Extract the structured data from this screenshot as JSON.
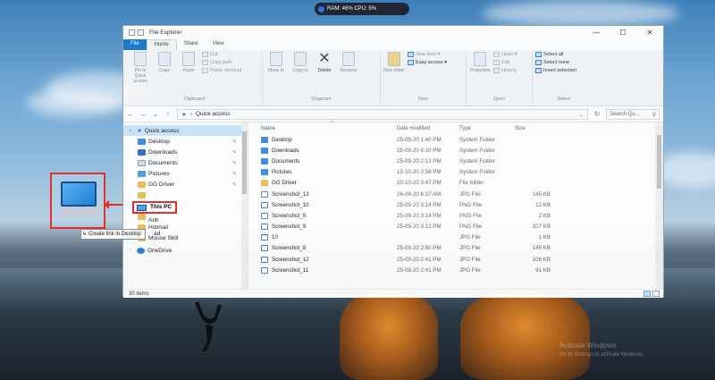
{
  "status_pill": {
    "text": "RAM: 46%  CPU: 5%"
  },
  "watermark": {
    "line1": "Activate Windows",
    "line2": "Go to Settings to activate Windows."
  },
  "desktop": {
    "drag_label": "This PC",
    "tooltip": "Create link in Desktop",
    "behind_labels": [
      "Anh",
      "Hotmail",
      "Mouse Skill",
      "ad"
    ]
  },
  "window": {
    "title": "File Explorer",
    "controls": {
      "minimize": "—",
      "maximize": "☐",
      "close": "✕"
    },
    "tabs": {
      "file": "File",
      "home": "Home",
      "share": "Share",
      "view": "View"
    },
    "ribbon": {
      "clipboard": {
        "name": "Clipboard",
        "pin": "Pin to Quick access",
        "copy": "Copy",
        "paste": "Paste",
        "cut": "Cut",
        "copy_path": "Copy path",
        "paste_shortcut": "Paste shortcut"
      },
      "organize": {
        "name": "Organize",
        "move_to": "Move to",
        "copy_to": "Copy to",
        "delete": "Delete",
        "rename": "Rename"
      },
      "new": {
        "name": "New",
        "new_folder": "New folder",
        "new_item": "New item ▾",
        "easy_access": "Easy access ▾"
      },
      "open": {
        "name": "Open",
        "properties": "Properties",
        "open": "Open ▾",
        "edit": "Edit",
        "history": "History"
      },
      "select": {
        "name": "Select",
        "select_all": "Select all",
        "select_none": "Select none",
        "invert": "Invert selection"
      }
    },
    "address": {
      "path": "Quick access",
      "search_placeholder": "Search Qu..."
    },
    "nav": {
      "quick_access": "Quick access",
      "items": [
        {
          "label": "Desktop",
          "icon": "desktop-icon",
          "pinned": true
        },
        {
          "label": "Downloads",
          "icon": "download-icon",
          "pinned": true
        },
        {
          "label": "Documents",
          "icon": "documents-icon",
          "pinned": true
        },
        {
          "label": "Pictures",
          "icon": "pictures-icon",
          "pinned": true
        },
        {
          "label": "GG Driver",
          "icon": "folder-icon",
          "pinned": true
        },
        {
          "label": "",
          "icon": "folder-icon",
          "pinned": false
        },
        {
          "label": "",
          "icon": "folder-icon",
          "pinned": false
        },
        {
          "label": "",
          "icon": "folder-icon",
          "pinned": false
        },
        {
          "label": "Hotmail",
          "icon": "folder-icon",
          "pinned": false
        },
        {
          "label": "Mouse Skill",
          "icon": "folder-icon",
          "pinned": false
        }
      ],
      "onedrive": "OneDrive"
    },
    "columns": {
      "name": "Name",
      "date": "Date modified",
      "type": "Type",
      "size": "Size"
    },
    "files": [
      {
        "name": "Desktop",
        "date": "25-09-20 1:40 PM",
        "type": "System Folder",
        "size": "",
        "kind": "folderblue"
      },
      {
        "name": "Downloads",
        "date": "25-09-20 4:10 PM",
        "type": "System Folder",
        "size": "",
        "kind": "folderblue"
      },
      {
        "name": "Documents",
        "date": "25-09-20 2:13 PM",
        "type": "System Folder",
        "size": "",
        "kind": "folderblue"
      },
      {
        "name": "Pictures",
        "date": "15-10-20 3:56 PM",
        "type": "System Folder",
        "size": "",
        "kind": "folderblue"
      },
      {
        "name": "GG Driver",
        "date": "20-10-20 3:47 PM",
        "type": "File folder",
        "size": "",
        "kind": "folder"
      },
      {
        "name": "Screenshot_13",
        "date": "26-09-20 6:37 AM",
        "type": "JPG File",
        "size": "145 KB",
        "kind": "img"
      },
      {
        "name": "Screenshot_10",
        "date": "25-09-20 3:14 PM",
        "type": "PNG File",
        "size": "12 KB",
        "kind": "img"
      },
      {
        "name": "Screenshot_9",
        "date": "25-09-20 3:14 PM",
        "type": "PNG File",
        "size": "2 KB",
        "kind": "img"
      },
      {
        "name": "Screenshot_9",
        "date": "25-09-20 3:12 PM",
        "type": "PNG File",
        "size": "107 KB",
        "kind": "img"
      },
      {
        "name": "10",
        "date": "",
        "type": "JPG File",
        "size": "1 KB",
        "kind": "img"
      },
      {
        "name": "Screenshot_8",
        "date": "25-09-20 2:50 PM",
        "type": "JPG File",
        "size": "145 KB",
        "kind": "img"
      },
      {
        "name": "Screenshot_12",
        "date": "25-09-20 2:41 PM",
        "type": "JPG File",
        "size": "106 KB",
        "kind": "img"
      },
      {
        "name": "Screenshot_11",
        "date": "25-09-20 2:41 PM",
        "type": "JPG File",
        "size": "91 KB",
        "kind": "img"
      }
    ],
    "status": "30 items"
  }
}
